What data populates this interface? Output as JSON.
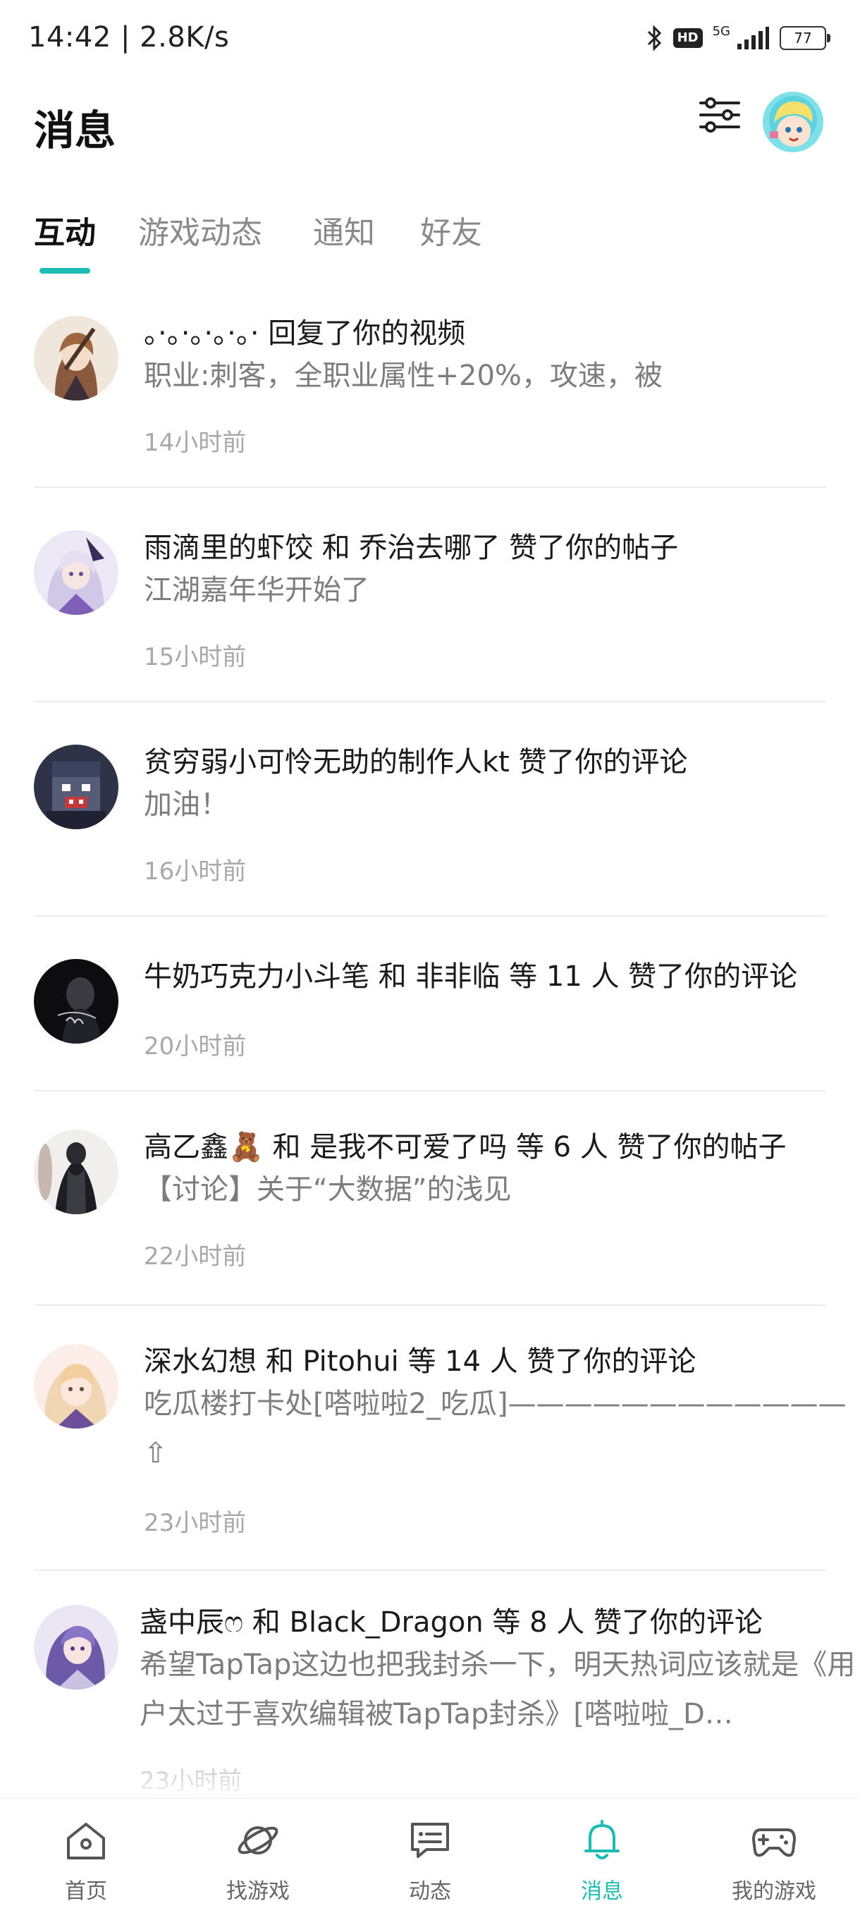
{
  "status": {
    "time": "14:42 | 2.8K/s",
    "hd": "HD",
    "network": "5G",
    "battery": "77"
  },
  "header": {
    "title": "消息"
  },
  "tabs": [
    {
      "label": "互动",
      "active": true
    },
    {
      "label": "游戏动态",
      "active": false
    },
    {
      "label": "通知",
      "active": false
    },
    {
      "label": "好友",
      "active": false
    }
  ],
  "messages": [
    {
      "title": "。·。·。·。·。· 回复了你的视频",
      "body": "职业:刺客，全职业属性+20%，攻速，被",
      "time": "14小时前"
    },
    {
      "title": "雨滴里的虾饺 和 乔治去哪了 赞了你的帖子",
      "body": "江湖嘉年华开始了",
      "time": "15小时前"
    },
    {
      "title": "贫穷弱小可怜无助的制作人kt 赞了你的评论",
      "body": "加油！",
      "time": "16小时前"
    },
    {
      "title": "牛奶巧克力小斗笔 和 非非临 等 11 人 赞了你的评论",
      "body": "",
      "time": "20小时前"
    },
    {
      "title": "高乙鑫🧸 和 是我不可爱了吗 等 6 人 赞了你的帖子",
      "body": "【讨论】关于“大数据”的浅见",
      "time": "22小时前"
    },
    {
      "title": "深水幻想 和 Pitohui 等 14 人 赞了你的评论",
      "body": "吃瓜楼打卡处[嗒啦啦2_吃瓜]————————————",
      "body2": "⇧",
      "time": "23小时前"
    },
    {
      "title": "盏中辰ෆ 和 Black_Dragon 等 8 人 赞了你的评论",
      "body": "希望TapTap这边也把我封杀一下，明天热词应该就是《用户太过于喜欢编辑被TapTap封杀》[嗒啦啦_D…",
      "time": "23小时前"
    }
  ],
  "bottom_nav": [
    {
      "label": "首页",
      "icon": "home-icon",
      "active": false
    },
    {
      "label": "找游戏",
      "icon": "planet-icon",
      "active": false
    },
    {
      "label": "动态",
      "icon": "feed-icon",
      "active": false
    },
    {
      "label": "消息",
      "icon": "bell-icon",
      "active": true
    },
    {
      "label": "我的游戏",
      "icon": "gamepad-icon",
      "active": false
    }
  ],
  "colors": {
    "accent": "#1cbbb4",
    "text_primary": "#1a1a1a",
    "text_secondary": "#7d7d7d",
    "text_time": "#a8a8a8"
  }
}
